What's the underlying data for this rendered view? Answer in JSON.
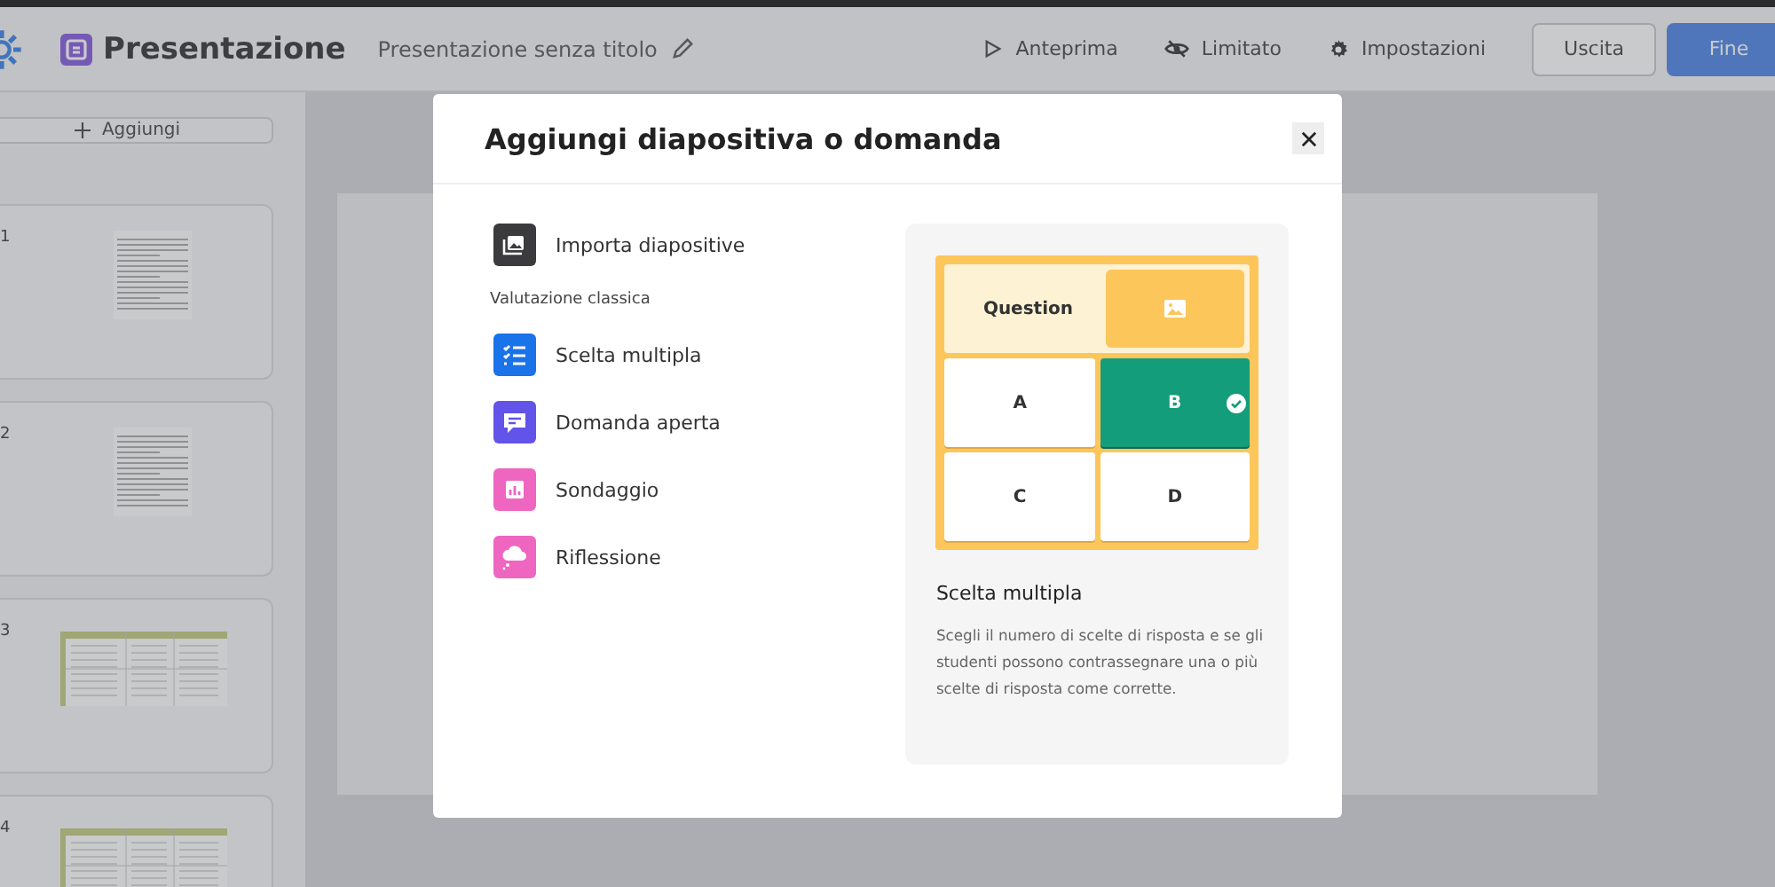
{
  "topbar": {
    "app_name": "Presentazione",
    "doc_title": "Presentazione senza titolo",
    "actions": [
      {
        "label": "Anteprima",
        "kind": "preview"
      },
      {
        "label": "Limitato",
        "kind": "visibility"
      },
      {
        "label": "Impostazioni",
        "kind": "settings"
      }
    ],
    "exit_button": "Uscita",
    "finish_button": "Fine"
  },
  "sidebar": {
    "add_button": "Aggiungi",
    "slides": [
      {
        "number": "1",
        "kind": "text"
      },
      {
        "number": "2",
        "kind": "text"
      },
      {
        "number": "3",
        "kind": "table"
      },
      {
        "number": "4",
        "kind": "table"
      }
    ]
  },
  "dialog": {
    "title": "Aggiungi diapositiva o domanda",
    "import_option": "Importa diapositive",
    "section_heading": "Valutazione classica",
    "options": [
      {
        "label": "Scelta multipla",
        "kind": "multiple-choice",
        "color": "#1a73e8"
      },
      {
        "label": "Domanda aperta",
        "kind": "open",
        "color": "#6254e8"
      },
      {
        "label": "Sondaggio",
        "kind": "poll",
        "color": "#ee66bf"
      },
      {
        "label": "Riflessione",
        "kind": "reflection",
        "color": "#ee66bf"
      }
    ],
    "preview": {
      "question": "Question",
      "answers": [
        {
          "label": "A",
          "correct": false
        },
        {
          "label": "B",
          "correct": true
        },
        {
          "label": "C",
          "correct": false
        },
        {
          "label": "D",
          "correct": false
        }
      ],
      "title": "Scelta multipla",
      "description": "Scegli il numero di scelte di risposta e se gli studenti possono contrassegnare una o più scelte di risposta come corrette."
    }
  }
}
